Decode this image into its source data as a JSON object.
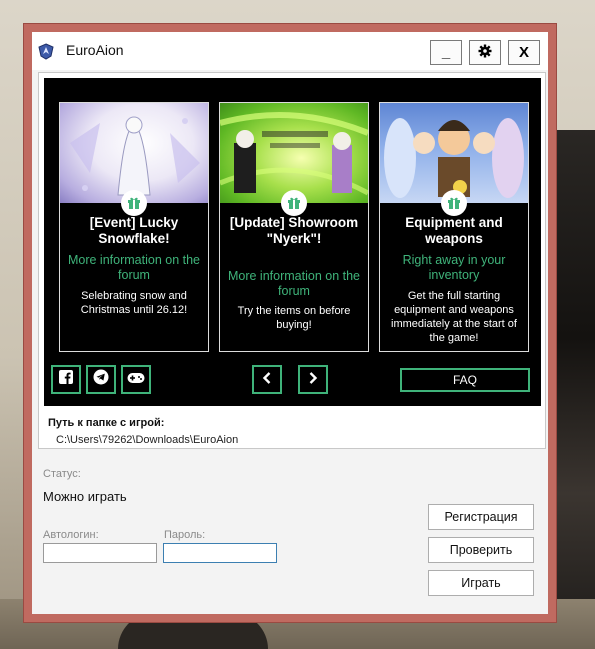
{
  "app": {
    "title": "EuroAion"
  },
  "titlebar": {
    "minimize_label": "_",
    "settings_icon": "gear-icon",
    "close_label": "X"
  },
  "cards": [
    {
      "title": "[Event] Lucky Snowflake!",
      "more": "More information on the forum",
      "desc": "Selebrating snow and Christmas until 26.12!",
      "image_icon": "event-banner-image"
    },
    {
      "title": "[Update] Showroom \"Nyerk\"!",
      "more": "More information on the forum",
      "desc": "Try the items on before buying!",
      "image_icon": "showroom-banner-image"
    },
    {
      "title": "Equipment and weapons",
      "more": "Right away in your inventory",
      "desc": "Get the full starting equipment and weapons immediately at the start of the game!",
      "image_icon": "equipment-banner-image"
    }
  ],
  "social": [
    "facebook-icon",
    "telegram-icon",
    "gamepad-icon"
  ],
  "pager": [
    "chevron-left-icon",
    "chevron-right-icon"
  ],
  "faq_label": "FAQ",
  "path": {
    "label": "Путь к папке с игрой:",
    "value": "C:\\Users\\79262\\Downloads\\EuroAion"
  },
  "status": {
    "label": "Статус:",
    "value": "Можно играть"
  },
  "login": {
    "autologin_label": "Автологин:",
    "autologin_value": "",
    "password_label": "Пароль:",
    "password_value": ""
  },
  "actions": {
    "register": "Регистрация",
    "check": "Проверить",
    "play": "Играть"
  },
  "colors": {
    "frame": "#c06a60",
    "accent": "#3fb37a",
    "news_bg": "#000000"
  }
}
